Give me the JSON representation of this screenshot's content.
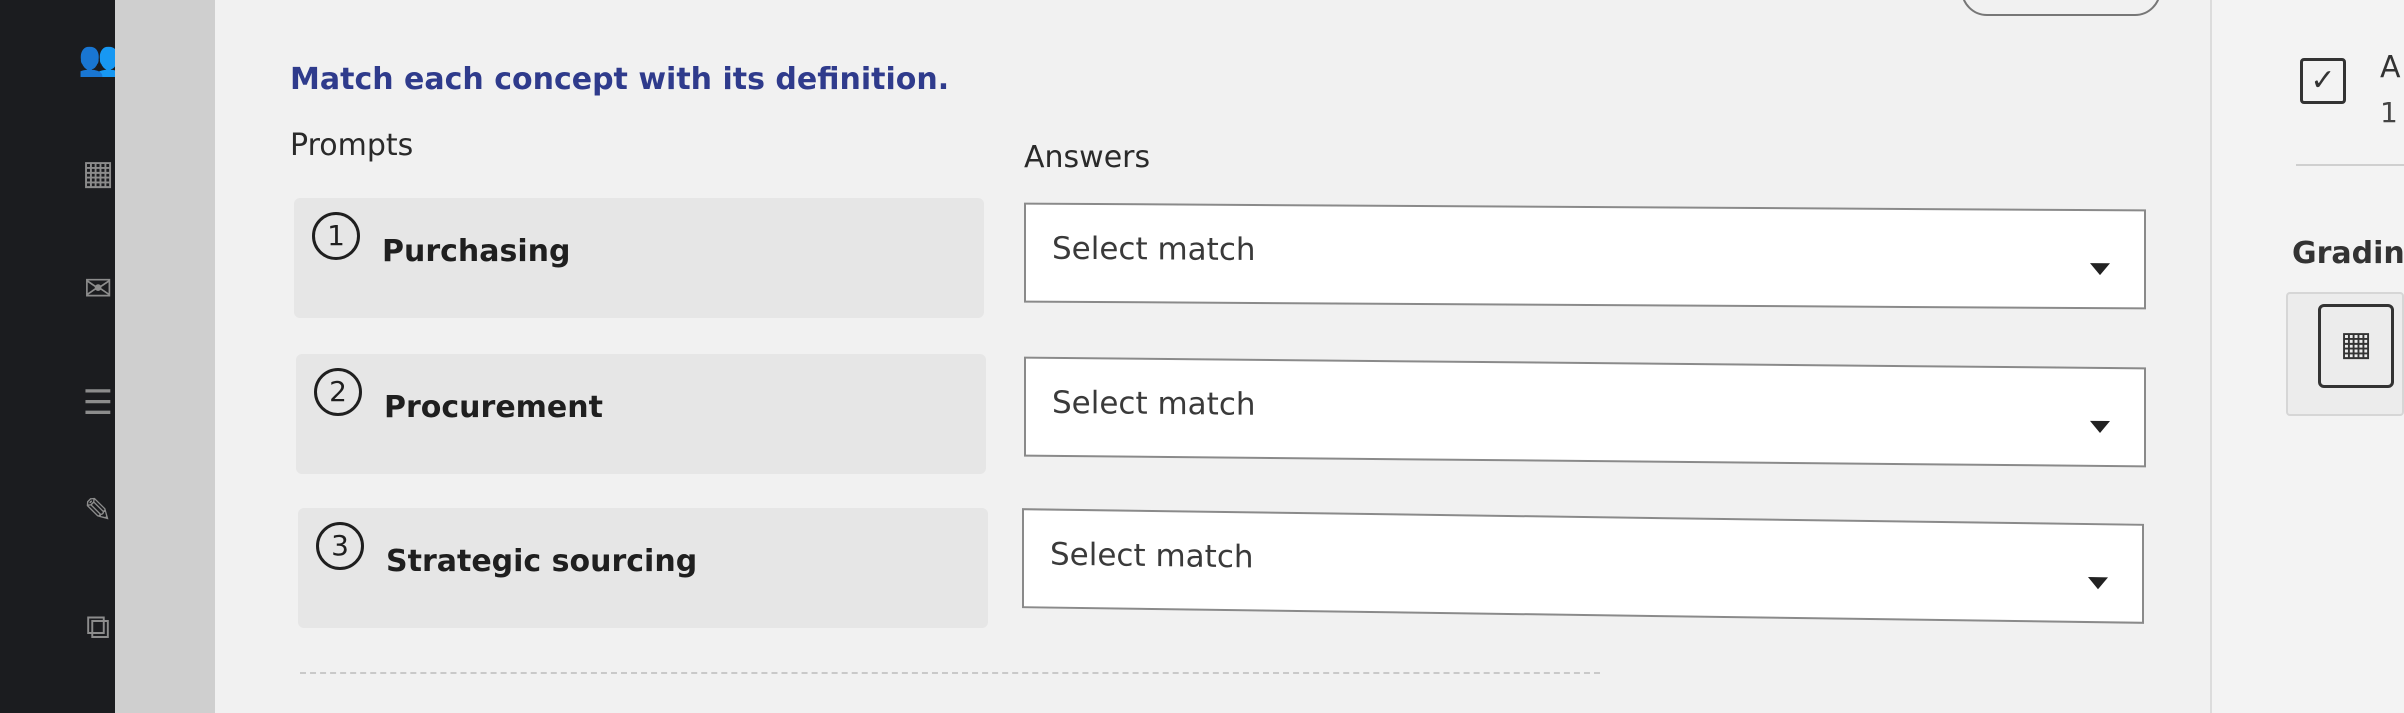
{
  "question": {
    "title": "Match each concept with its definition.",
    "prompts_label": "Prompts",
    "answers_label": "Answers",
    "items": [
      {
        "number": "1",
        "prompt": "Purchasing",
        "answer_placeholder": "Select match"
      },
      {
        "number": "2",
        "prompt": "Procurement",
        "answer_placeholder": "Select match"
      },
      {
        "number": "3",
        "prompt": "Strategic sourcing",
        "answer_placeholder": "Select match"
      }
    ]
  },
  "right_panel": {
    "check_icon": "✓",
    "letter": "A",
    "number": "1",
    "grading_label": "Gradin",
    "calc_icon": "▦"
  },
  "left_rail": {
    "icons": [
      "👥",
      "▦",
      "✉",
      "☰",
      "✎",
      "⧉"
    ]
  },
  "icon_names": [
    "people-icon",
    "calendar-icon",
    "mail-icon",
    "list-icon",
    "pencil-icon",
    "window-icon"
  ]
}
